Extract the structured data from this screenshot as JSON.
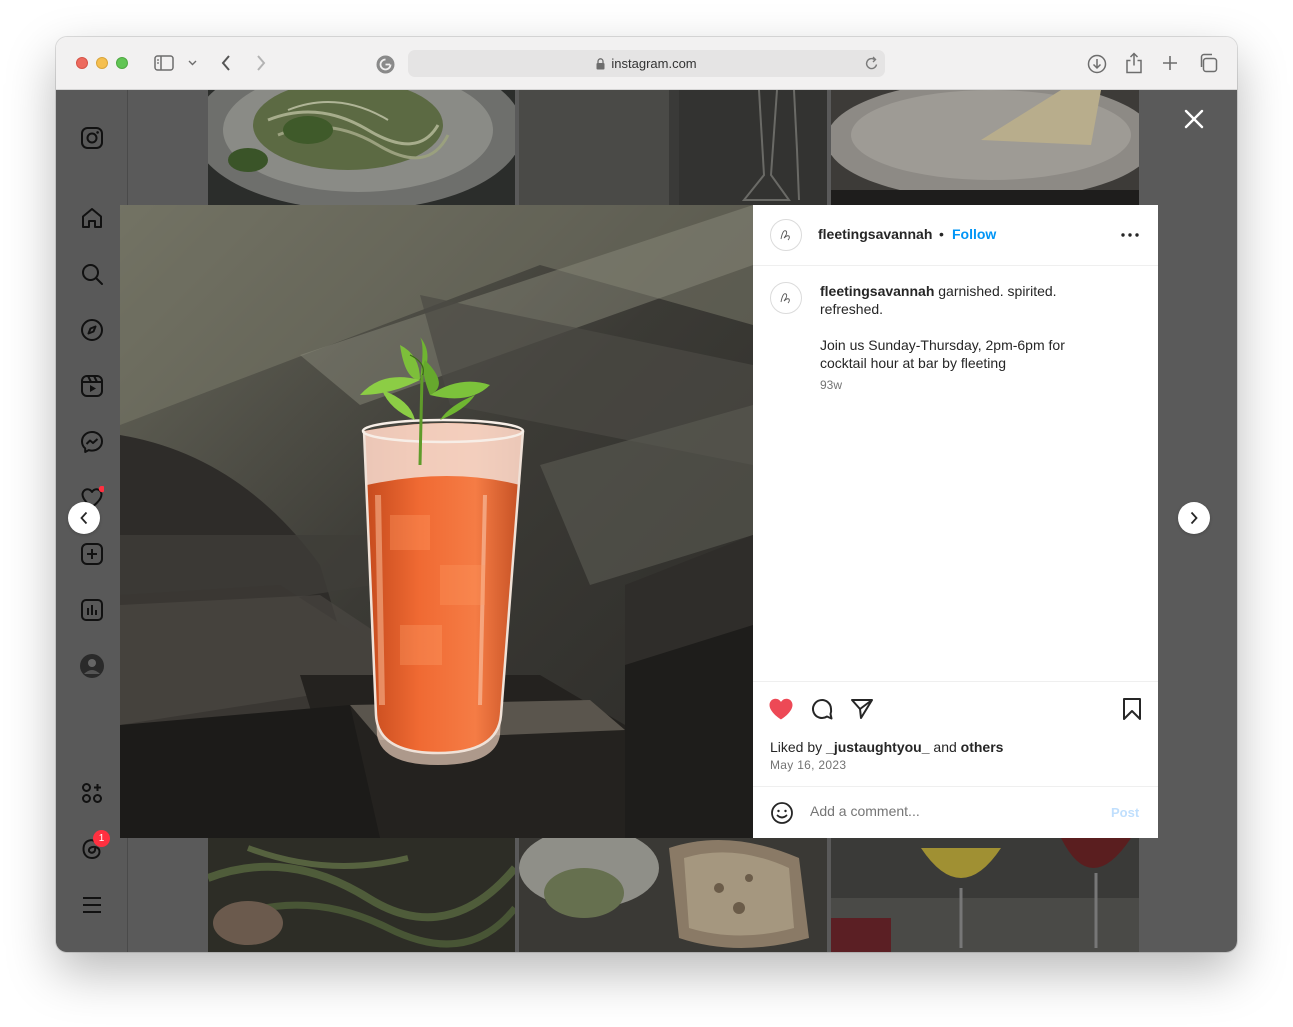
{
  "browser": {
    "url": "instagram.com"
  },
  "sidebar": {
    "items": [
      {
        "icon": "instagram-logo-icon"
      },
      {
        "icon": "home-icon"
      },
      {
        "icon": "search-icon"
      },
      {
        "icon": "explore-icon"
      },
      {
        "icon": "reels-icon"
      },
      {
        "icon": "messenger-icon"
      },
      {
        "icon": "notifications-heart-icon"
      },
      {
        "icon": "create-icon"
      },
      {
        "icon": "dashboard-icon"
      },
      {
        "icon": "profile-avatar"
      },
      {
        "icon": "also-from-meta-icon"
      },
      {
        "icon": "threads-icon",
        "badge": "1"
      },
      {
        "icon": "menu-icon"
      }
    ]
  },
  "post": {
    "username": "fleetingsavannah",
    "separator": "•",
    "follow_label": "Follow",
    "caption_user": "fleetingsavannah",
    "caption_line1": "garnished. spirited. refreshed.",
    "caption_line2": "Join us Sunday-Thursday, 2pm-6pm for cocktail hour at bar by fleeting",
    "time_ago": "93w",
    "liked_prefix": "Liked by",
    "liked_user": "_justaughtyou_",
    "liked_and": "and",
    "liked_others": "others",
    "date": "May 16, 2023",
    "comment_placeholder": "Add a comment...",
    "post_label": "Post",
    "liked": true
  },
  "colors": {
    "accent": "#0095f6",
    "like_red": "#ed4956",
    "backdrop": "#5a5a5a"
  }
}
